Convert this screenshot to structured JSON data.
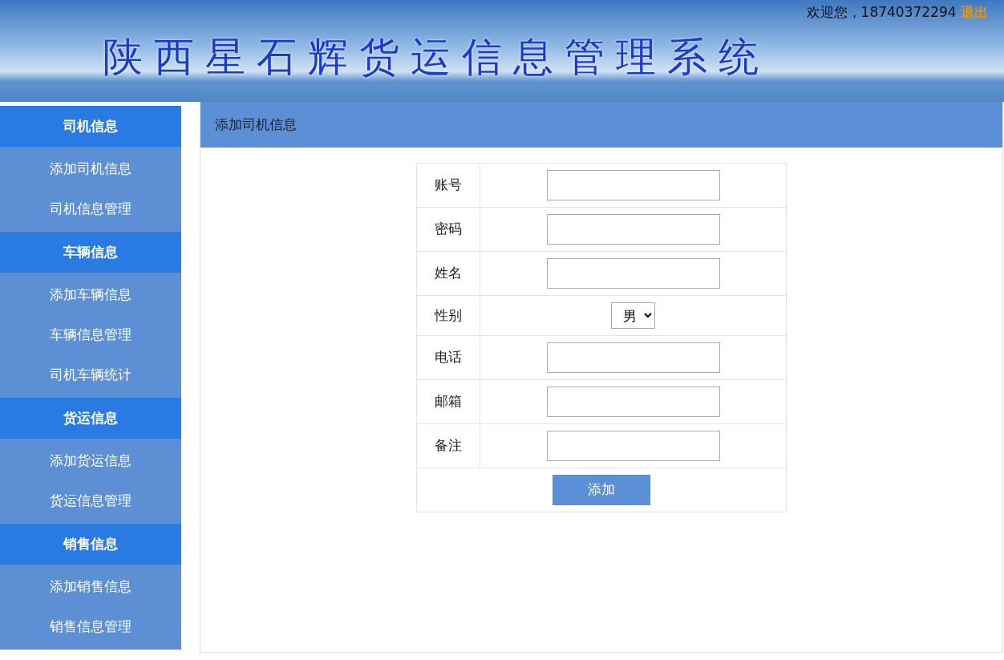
{
  "header": {
    "title": "陕西星石辉货运信息管理系统",
    "welcome": "欢迎您，18740372294",
    "logout": "退出"
  },
  "sidebar": {
    "groups": [
      {
        "title": "司机信息",
        "items": [
          {
            "label": "添加司机信息"
          },
          {
            "label": "司机信息管理"
          }
        ]
      },
      {
        "title": "车辆信息",
        "items": [
          {
            "label": "添加车辆信息"
          },
          {
            "label": "车辆信息管理"
          },
          {
            "label": "司机车辆统计"
          }
        ]
      },
      {
        "title": "货运信息",
        "items": [
          {
            "label": "添加货运信息"
          },
          {
            "label": "货运信息管理"
          }
        ]
      },
      {
        "title": "销售信息",
        "items": [
          {
            "label": "添加销售信息"
          },
          {
            "label": "销售信息管理"
          }
        ]
      }
    ]
  },
  "panel": {
    "title": "添加司机信息"
  },
  "form": {
    "fields": [
      {
        "label": "账号",
        "kind": "text"
      },
      {
        "label": "密码",
        "kind": "text"
      },
      {
        "label": "姓名",
        "kind": "text"
      },
      {
        "label": "性别",
        "kind": "select",
        "value": "男"
      },
      {
        "label": "电话",
        "kind": "text"
      },
      {
        "label": "邮箱",
        "kind": "text"
      },
      {
        "label": "备注",
        "kind": "text"
      }
    ],
    "submit": "添加"
  }
}
